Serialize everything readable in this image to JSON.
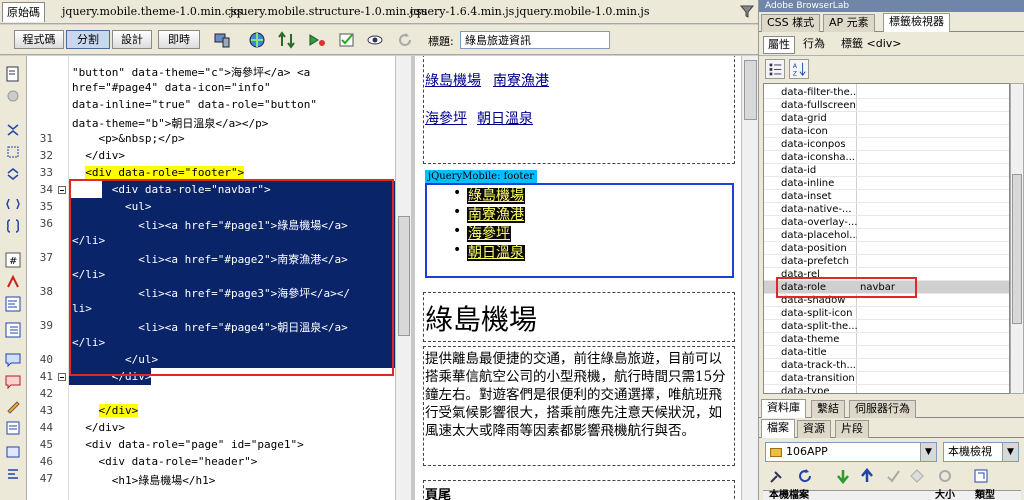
{
  "doc_tabs": [
    "原始碼",
    "jquery.mobile.theme-1.0.min.css",
    "jquery.mobile.structure-1.0.min.css",
    "jquery-1.6.4.min.js",
    "jquery.mobile-1.0.min.js"
  ],
  "toolbar": {
    "code_label": "程式碼",
    "split_label": "分割",
    "design_label": "設計",
    "live_label": "即時",
    "title_label": "標題:",
    "title_value": "綠島旅遊資訊"
  },
  "code_lines": [
    {
      "num": "",
      "text": "\"button\" data-theme=\"c\">海參坪</a> <a"
    },
    {
      "num": "",
      "text": "href=\"#page4\" data-icon=\"info\""
    },
    {
      "num": "",
      "text": "data-inline=\"true\" data-role=\"button\""
    },
    {
      "num": "",
      "text": "data-theme=\"b\">朝日溫泉</a></p>"
    },
    {
      "num": "31",
      "text": "    <p>&nbsp;</p>"
    },
    {
      "num": "32",
      "text": "  </div>"
    },
    {
      "num": "33",
      "text": "  <div data-role=\"footer\">"
    },
    {
      "num": "34",
      "text": "      <div data-role=\"navbar\">"
    },
    {
      "num": "35",
      "text": "        <ul>"
    },
    {
      "num": "36",
      "text": "          <li><a href=\"#page1\">綠島機場</a>"
    },
    {
      "num": "",
      "text": "</li>"
    },
    {
      "num": "37",
      "text": "          <li><a href=\"#page2\">南寮漁港</a>"
    },
    {
      "num": "",
      "text": "</li>"
    },
    {
      "num": "38",
      "text": "          <li><a href=\"#page3\">海參坪</a></"
    },
    {
      "num": "",
      "text": "li>"
    },
    {
      "num": "39",
      "text": "          <li><a href=\"#page4\">朝日溫泉</a>"
    },
    {
      "num": "",
      "text": "</li>"
    },
    {
      "num": "40",
      "text": "        </ul>"
    },
    {
      "num": "41",
      "text": "      </div>"
    },
    {
      "num": "42",
      "text": ""
    },
    {
      "num": "43",
      "text": "    </div>"
    },
    {
      "num": "44",
      "text": "  </div>"
    },
    {
      "num": "45",
      "text": "  <div data-role=\"page\" id=\"page1\">"
    },
    {
      "num": "46",
      "text": "    <div data-role=\"header\">"
    },
    {
      "num": "47",
      "text": "      <h1>綠島機場</h1>"
    }
  ],
  "design": {
    "link_row1": [
      "綠島機場",
      "南寮漁港"
    ],
    "link_row2": [
      "海參坪",
      "朝日溫泉"
    ],
    "footer_tag": "jQueryMobile: footer",
    "nav_items": [
      "綠島機場",
      "南寮漁港",
      "海參坪",
      "朝日溫泉"
    ],
    "heading": "綠島機場",
    "paragraph": "提供離島最便捷的交通，前往綠島旅遊，目前可以搭乘華信航空公司的小型飛機，航行時間只需15分鐘左右。對遊客們是很便利的交通選擇，唯航班飛行受氣候影響很大，搭乘前應先注意天候狀況，如風速太大或降雨等因素都影響飛機航行與否。",
    "footer_heading": "頁尾"
  },
  "right_panel": {
    "top_title": "Adobe BrowserLab",
    "tabs": [
      "CSS 樣式",
      "AP 元素",
      "標籤檢視器"
    ],
    "sub_tabs": [
      "屬性",
      "行為"
    ],
    "tag_label": "標籤 <div>",
    "properties": [
      {
        "name": "data-filter-the...",
        "value": ""
      },
      {
        "name": "data-fullscreen",
        "value": ""
      },
      {
        "name": "data-grid",
        "value": ""
      },
      {
        "name": "data-icon",
        "value": ""
      },
      {
        "name": "data-iconpos",
        "value": ""
      },
      {
        "name": "data-iconsha...",
        "value": ""
      },
      {
        "name": "data-id",
        "value": ""
      },
      {
        "name": "data-inline",
        "value": ""
      },
      {
        "name": "data-inset",
        "value": ""
      },
      {
        "name": "data-native-...",
        "value": ""
      },
      {
        "name": "data-overlay-...",
        "value": ""
      },
      {
        "name": "data-placehol...",
        "value": ""
      },
      {
        "name": "data-position",
        "value": ""
      },
      {
        "name": "data-prefetch",
        "value": ""
      },
      {
        "name": "data-rel",
        "value": ""
      },
      {
        "name": "data-role",
        "value": "navbar"
      },
      {
        "name": "data-shadow",
        "value": ""
      },
      {
        "name": "data-split-icon",
        "value": ""
      },
      {
        "name": "data-split-the...",
        "value": ""
      },
      {
        "name": "data-theme",
        "value": ""
      },
      {
        "name": "data-title",
        "value": ""
      },
      {
        "name": "data-track-th...",
        "value": ""
      },
      {
        "name": "data-transition",
        "value": ""
      },
      {
        "name": "data-type",
        "value": ""
      }
    ],
    "lower_tabs": [
      "資料庫",
      "繫結",
      "伺服器行為"
    ],
    "files_tabs": [
      "檔案",
      "資源",
      "片段"
    ],
    "site_name": "106APP",
    "view_mode": "本機檢視",
    "files_header": [
      "本機檔案",
      "大小",
      "類型"
    ]
  }
}
